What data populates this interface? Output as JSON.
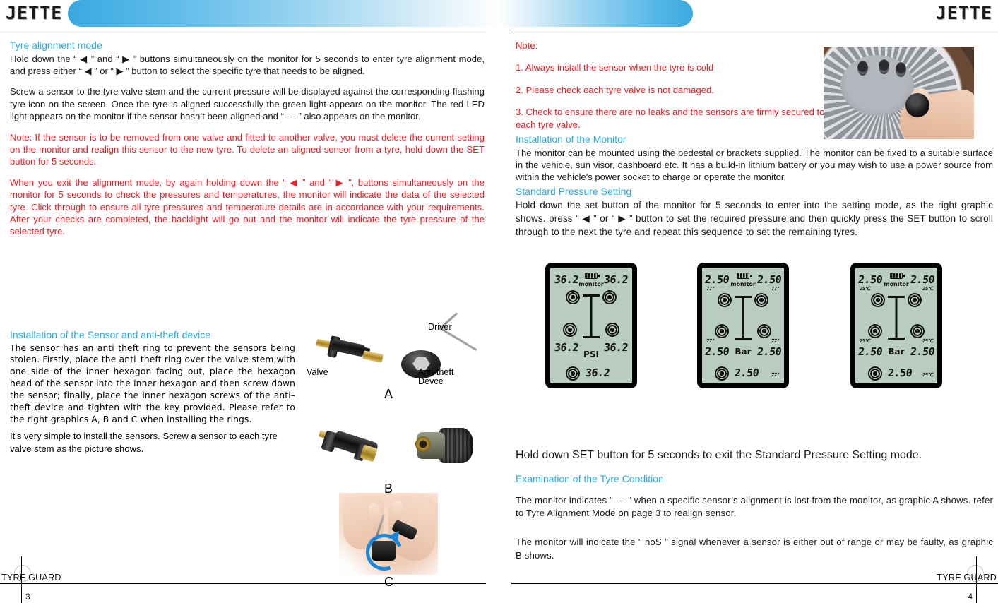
{
  "brand": {
    "logo": "JETTE",
    "footer": "TYRE GUARD"
  },
  "left_page": {
    "page_number": "3",
    "sections": {
      "tyre_alignment_heading": "Tyre alignment mode",
      "tyre_alignment_p1": "Hold down the “ ◀ ” and “ ▶ ” buttons simultaneously on the monitor for 5 seconds to enter tyre alignment mode, and press either “ ◀ ” or “ ▶ ” button to select the specific tyre that needs to be aligned.",
      "tyre_alignment_p2": "Screw a sensor to the tyre valve stem and the current pressure will be displayed against the corresponding flashing tyre icon on the screen. Once the tyre is aligned successfully the green light appears on the monitor. The red LED light appears on the monitor if the sensor hasn’t been aligned and “- - -” also appears on the monitor.",
      "note_red": "Note: If the sensor is to be removed from one valve and fitted to another valve, you must delete the current setting on the monitor and realign this sensor to the new tyre. To delete an aligned sensor from a tyre, hold down the SET button for 5 seconds.",
      "exit_red": "When you exit the alignment mode, by again holding down the “ ◀ ” and “ ▶ ”, buttons simultaneously on the monitor for 5 seconds to check the pressures and temperatures, the monitor will indicate the data of the selected tyre. Click through to ensure all tyre pressures and temperature details are in accordance with your requirements. After your checks are completed, the backlight will go out and the monitor will indicate the tyre pressure of the selected tyre.",
      "install_sensor_heading": "Installation of the Sensor and anti-theft device",
      "install_sensor_p1": "The sensor has an anti theft ring to prevent the sensors being stolen. Firstly, place the anti_theft ring over the valve stem,with one side of the inner hexagon facing out, place the hexagon head of the sensor into the inner hexagon and then screw down the sensor; finally, place the inner hexagon screws of the anti–theft device and tighten with the key provided. Please refer to the right graphics A, B and C when installing the rings.",
      "install_sensor_p2": "It's very simple to install the sensors. Screw a sensor to each tyre valve stem as the picture shows."
    },
    "figures": {
      "valve_label": "Valve",
      "driver_label": "Driver",
      "antitheft_label_line1": "Anti-theft",
      "antitheft_label_line2": "Devce",
      "fig_a": "A",
      "fig_b": "B",
      "fig_c": "C"
    }
  },
  "right_page": {
    "page_number": "4",
    "sections": {
      "note_heading": "Note:",
      "note_1": "1. Always install the sensor when the tyre is cold",
      "note_2": "2. Please check each tyre valve is not damaged.",
      "note_3": "3. Check to ensure there are no leaks and the sensors are firmly secured to each tyre valve.",
      "install_monitor_heading": "Installation of the Monitor",
      "install_monitor_p": "The monitor can be mounted using the pedestal or brackets supplied. The monitor can be fixed to a suitable surface in the vehicle, sun visor, dashboard etc. It has a build-in lithium battery or you may wish to use a power source from within the vehicle's power socket to charge or operate the monitor.",
      "standard_pressure_heading": "Standard Pressure Setting",
      "standard_pressure_p": "Hold down the set button of the monitor for 5 seconds to enter into the setting mode, as the right graphic shows. press “ ◀ ” or “ ▶ ” button to set the required pressure,and then quickly press the SET button to scroll through to the next the tyre and repeat this sequence to set the remaining tyres.",
      "exit_line": "Hold down SET button for 5 seconds to exit the Standard Pressure Setting mode.",
      "examination_heading": "Examination of the Tyre Condition",
      "examination_p1": "The monitor indicates \" --- \" when a specific sensor’s alignment is lost from the monitor, as graphic A shows. refer to Tyre Alignment Mode on page 3 to realign sensor.",
      "examination_p2": "The monitor will indicate the \" noS \" signal whenever a sensor is either out of range or may be faulty, as graphic B shows."
    },
    "lcd_displays": [
      {
        "id": "lcd-psi",
        "battery_label": "monitor",
        "unit": "PSI",
        "front_left": "36.2",
        "front_right": "36.2",
        "rear_left": "36.2",
        "rear_right": "36.2",
        "spare": "36.2",
        "temp_front_left": "",
        "temp_front_right": "",
        "temp_rear_left": "",
        "temp_rear_right": "",
        "temp_spare": ""
      },
      {
        "id": "lcd-bar-f",
        "battery_label": "monitor",
        "unit": "Bar",
        "front_left": "2.50",
        "front_right": "2.50",
        "rear_left": "2.50",
        "rear_right": "2.50",
        "spare": "2.50",
        "temp_front_left": "77°",
        "temp_front_right": "77°",
        "temp_rear_left": "77°",
        "temp_rear_right": "77°",
        "temp_spare": "77°"
      },
      {
        "id": "lcd-bar-c",
        "battery_label": "monitor",
        "unit": "Bar",
        "front_left": "2.50",
        "front_right": "2.50",
        "rear_left": "2.50",
        "rear_right": "2.50",
        "spare": "2.50",
        "temp_front_left": "25℃",
        "temp_front_right": "25℃",
        "temp_rear_left": "25℃",
        "temp_rear_right": "25℃",
        "temp_spare": "25℃"
      }
    ]
  },
  "colors": {
    "heading_blue": "#29abe2",
    "note_red": "#ed1c24",
    "band_blue": "#3aa9e0",
    "lcd_green": "#b8ccc0"
  }
}
